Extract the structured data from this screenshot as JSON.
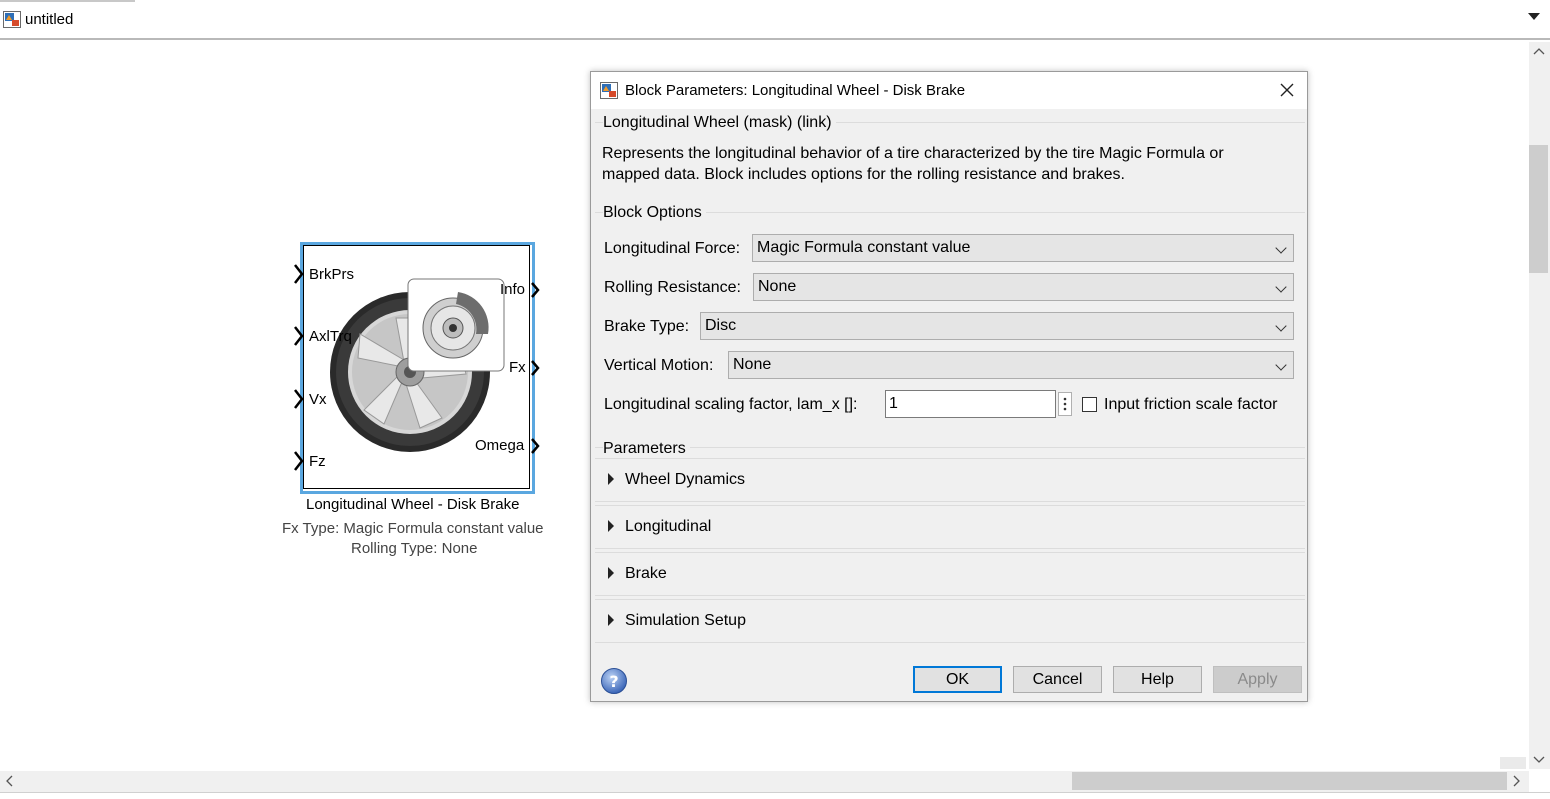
{
  "window": {
    "model_name": "untitled"
  },
  "block": {
    "inputs": [
      "BrkPrs",
      "AxlTrq",
      "Vx",
      "Fz"
    ],
    "outputs": [
      "Info",
      "Fx",
      "Omega"
    ],
    "name": "Longitudinal Wheel - Disk Brake",
    "desc_line1": "Fx Type: Magic Formula constant value",
    "desc_line2": "Rolling Type: None"
  },
  "dialog": {
    "title": "Block Parameters: Longitudinal Wheel - Disk Brake",
    "mask_header": "Longitudinal Wheel (mask) (link)",
    "description_line1": "Represents the longitudinal behavior of a tire characterized by the tire Magic Formula or",
    "description_line2": "mapped data. Block includes options for the rolling resistance and brakes.",
    "block_options_title": "Block Options",
    "longitudinal_force": {
      "label": "Longitudinal Force:",
      "value": "Magic Formula constant value"
    },
    "rolling_resistance": {
      "label": "Rolling Resistance:",
      "value": "None"
    },
    "brake_type": {
      "label": "Brake Type:",
      "value": "Disc"
    },
    "vertical_motion": {
      "label": "Vertical Motion:",
      "value": "None"
    },
    "scaling": {
      "label": "Longitudinal scaling factor, lam_x []:",
      "value": "1"
    },
    "friction_checkbox": {
      "label": "Input friction scale factor",
      "checked": false
    },
    "parameters_title": "Parameters",
    "sections": [
      "Wheel Dynamics",
      "Longitudinal",
      "Brake",
      "Simulation Setup"
    ],
    "buttons": {
      "ok": "OK",
      "cancel": "Cancel",
      "help": "Help",
      "apply": "Apply"
    }
  },
  "colors": {
    "selection_border": "#5aa7e0",
    "ok_focus_border": "#0078d7"
  }
}
